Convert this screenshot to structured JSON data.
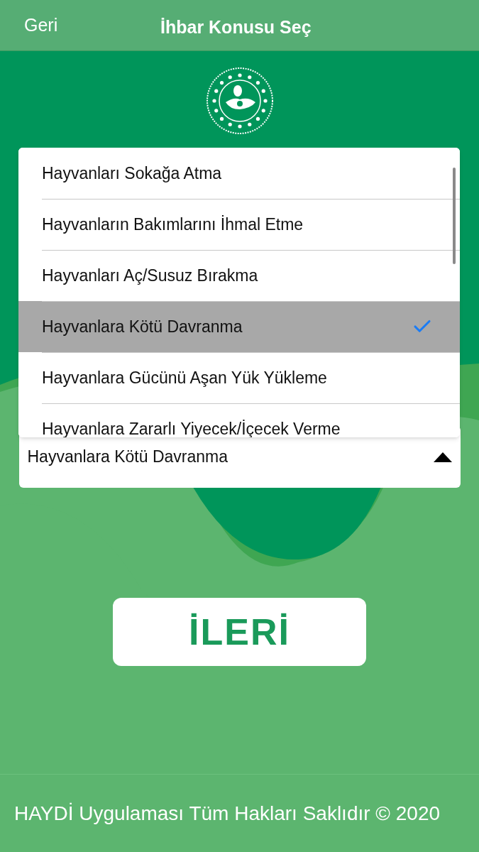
{
  "header": {
    "back": "Geri",
    "title": "İhbar Konusu Seç"
  },
  "menu": {
    "items": [
      {
        "label": "Hayvanları Sokağa Atma",
        "selected": false
      },
      {
        "label": "Hayvanların Bakımlarını İhmal Etme",
        "selected": false
      },
      {
        "label": "Hayvanları Aç/Susuz Bırakma",
        "selected": false
      },
      {
        "label": "Hayvanlara Kötü Davranma",
        "selected": true
      },
      {
        "label": "Hayvanlara Gücünü Aşan Yük Yükleme",
        "selected": false
      },
      {
        "label": "Hayvanlara Zararlı Yiyecek/İçecek Verme",
        "selected": false
      }
    ]
  },
  "select": {
    "value": "Hayvanlara Kötü Davranma",
    "open": true
  },
  "next_button": "İLERİ",
  "footer": "HAYDİ Uygulaması Tüm Hakları Saklıdır © 2020"
}
